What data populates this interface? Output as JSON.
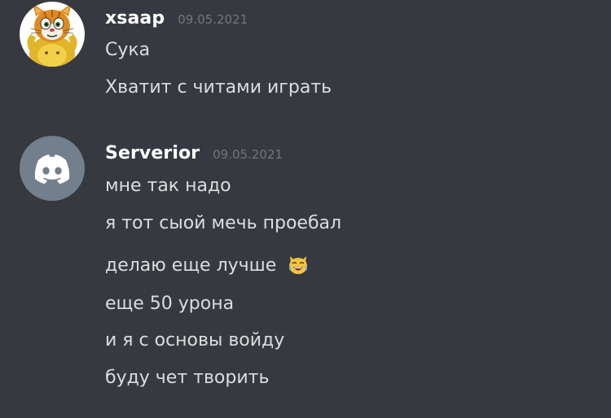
{
  "messages": [
    {
      "author": "xsaap",
      "timestamp": "09.05.2021",
      "avatar_icon": "cartoon-cat-icon",
      "lines": [
        "Сука",
        "Хватит с читами играть"
      ]
    },
    {
      "author": "Serverior",
      "timestamp": "09.05.2021",
      "avatar_icon": "discord-logo-icon",
      "avatar_color": "#747f8d",
      "lines": [
        "мне так надо",
        "я тот сыой мечь проебал",
        "делаю еще лучше",
        "еще 50 урона",
        "и я с основы войду",
        "буду чет творить"
      ],
      "emoji_after_line_3": "joy-cat-emoji"
    }
  ]
}
